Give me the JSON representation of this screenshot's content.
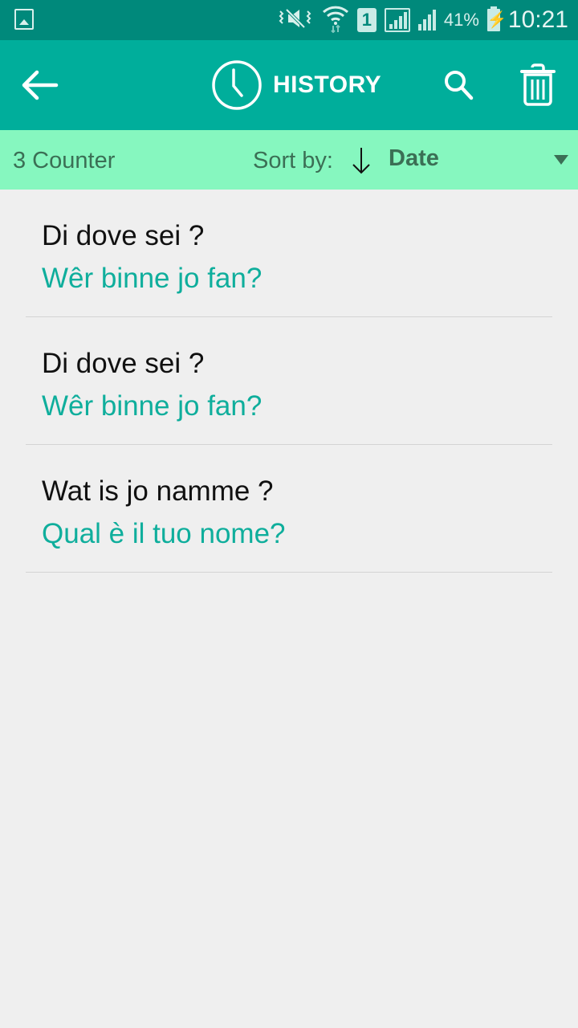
{
  "status_bar": {
    "battery_percent": "41%",
    "time": "10:21",
    "sim_label": "1"
  },
  "app_bar": {
    "title": "HISTORY"
  },
  "sort_bar": {
    "counter": "3 Counter",
    "sort_by_label": "Sort by:",
    "sort_value": "Date"
  },
  "history": {
    "items": [
      {
        "source": "Di dove sei ?",
        "translation": "Wêr binne jo fan?"
      },
      {
        "source": "Di dove sei ?",
        "translation": "Wêr binne jo fan?"
      },
      {
        "source": "Wat is jo namme ?",
        "translation": "Qual è il tuo nome?"
      }
    ]
  },
  "colors": {
    "status_bar": "#00897b",
    "app_bar": "#00ae9b",
    "sort_bar": "#86f7bf",
    "translation_text": "#0fae9c",
    "background": "#efefef"
  }
}
